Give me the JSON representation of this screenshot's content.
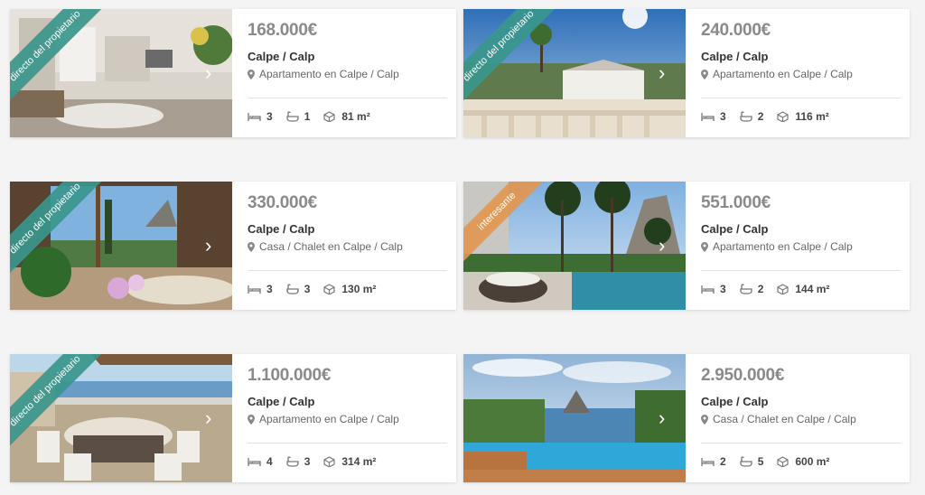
{
  "listings": [
    {
      "price": "168.000€",
      "city": "Calpe / Calp",
      "type": "Apartamento en Calpe / Calp",
      "beds": "3",
      "baths": "1",
      "area": "81 m²",
      "ribbon": "directo del propietario",
      "ribbon_color": "#3a968c"
    },
    {
      "price": "240.000€",
      "city": "Calpe / Calp",
      "type": "Apartamento en Calpe / Calp",
      "beds": "3",
      "baths": "2",
      "area": "116 m²",
      "ribbon": "directo del propietario",
      "ribbon_color": "#3a968c"
    },
    {
      "price": "330.000€",
      "city": "Calpe / Calp",
      "type": "Casa / Chalet en Calpe / Calp",
      "beds": "3",
      "baths": "3",
      "area": "130 m²",
      "ribbon": "directo del propietario",
      "ribbon_color": "#3a968c"
    },
    {
      "price": "551.000€",
      "city": "Calpe / Calp",
      "type": "Apartamento en Calpe / Calp",
      "beds": "3",
      "baths": "2",
      "area": "144 m²",
      "ribbon": "interesante",
      "ribbon_color": "#e29650"
    },
    {
      "price": "1.100.000€",
      "city": "Calpe / Calp",
      "type": "Apartamento en Calpe / Calp",
      "beds": "4",
      "baths": "3",
      "area": "314 m²",
      "ribbon": "directo del propietario",
      "ribbon_color": "#3a968c"
    },
    {
      "price": "2.950.000€",
      "city": "Calpe / Calp",
      "type": "Casa / Chalet en Calpe / Calp",
      "beds": "2",
      "baths": "5",
      "area": "600 m²",
      "ribbon": "",
      "ribbon_color": ""
    }
  ],
  "icons": {
    "next": "chevron-right-icon",
    "location": "map-pin-icon",
    "beds": "bed-icon",
    "baths": "bathtub-icon",
    "area": "area-cube-icon"
  }
}
